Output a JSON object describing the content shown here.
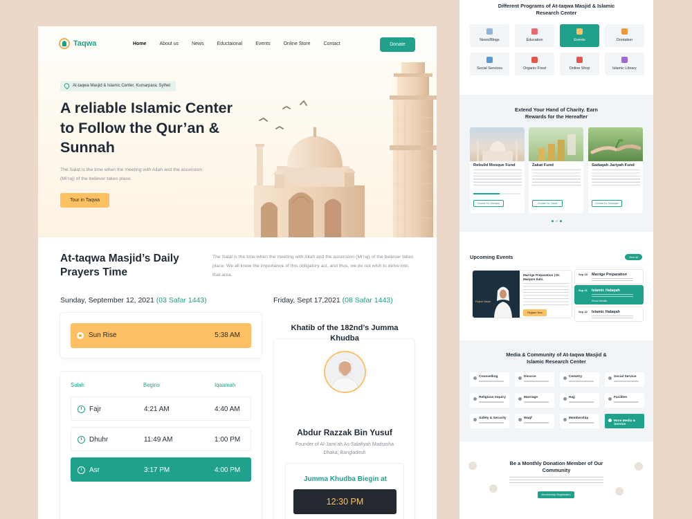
{
  "nav": {
    "brand": "Taqwa",
    "items": [
      "Home",
      "About us",
      "News",
      "Eductaional",
      "Events",
      "Online Store",
      "Contact"
    ],
    "donate": "Donate"
  },
  "hero": {
    "location": "At-taqwa Masjid & Islamic Center, Kumarpara, Sylhet",
    "title": "A reliable Islamic Center to Follow the Qur’an & Sunnah",
    "text": "The Salat is the time when the meeting with Allah and the ascension (Mi’raj) of the believer takes place.",
    "cta": "Tour in Taqwa"
  },
  "prayers": {
    "title": "At-taqwa Masjid’s Daily Prayers Time",
    "text": "The Salat is the time when the meeting with Allah and the ascension (Mi’raj) of the believer takes place. We all know the importance of this obligatory act, and thus, we do not wish to delve into that area.",
    "date": "Sunday, September 12, 2021",
    "hijri": "(03 Safar 1443)",
    "sunrise": {
      "label": "Sun Rise",
      "time": "5:38 AM"
    },
    "headers": [
      "Salah",
      "Begins",
      "Iqaamah"
    ],
    "rows": [
      {
        "name": "Fajr",
        "begins": "4:21 AM",
        "iqaamah": "4:40 AM"
      },
      {
        "name": "Dhuhr",
        "begins": "11:49 AM",
        "iqaamah": "1:00 PM"
      },
      {
        "name": "Asr",
        "begins": "3:17 PM",
        "iqaamah": "4:00 PM"
      }
    ]
  },
  "khutba": {
    "date": "Friday, Sept 17,2021",
    "hijri": "(08 Safar 1443)",
    "title": "Khatib of the 182nd’s Jumma Khudba",
    "name": "Abdur Razzak Bin Yusuf",
    "sub1": "Founder of Al-Jami’ah As-Salafiyah Madrasha",
    "sub2": "Dhaka, Bangladesh",
    "begin_label": "Jumma Khudba Biegin at",
    "begin_time": "12:30 PM"
  },
  "programs": {
    "title": "Different Programs of At-taqwa Masjid & Islamic Research Center",
    "items": [
      {
        "label": "News/Blogs",
        "icon": "newspaper-icon",
        "color": "#8fb3d9"
      },
      {
        "label": "Education",
        "icon": "education-icon",
        "color": "#e66b6b"
      },
      {
        "label": "Events",
        "icon": "calendar-icon",
        "color": "#fdc163"
      },
      {
        "label": "Dontation",
        "icon": "donation-icon",
        "color": "#e89a3c"
      },
      {
        "label": "Social Services",
        "icon": "social-icon",
        "color": "#5b9bd5"
      },
      {
        "label": "Organic Food",
        "icon": "food-icon",
        "color": "#e4584b"
      },
      {
        "label": "Online Shop",
        "icon": "shop-icon",
        "color": "#e4584b"
      },
      {
        "label": "Islamic Library",
        "icon": "library-icon",
        "color": "#9c6ad0"
      }
    ]
  },
  "charity": {
    "title": "Extend Your Hand of Charity. Earn Rewards for the Hereafter",
    "cards": [
      {
        "title": "Rebuild Mosque Fund",
        "button": "Donate for Mosque",
        "progress": 0.55
      },
      {
        "title": "Zakat Fund",
        "button": "Donate for Zakat",
        "progress": 0
      },
      {
        "title": "Sadaqah Jariyah Fund",
        "button": "Donate for Sadaqah",
        "progress": 0
      }
    ]
  },
  "events": {
    "title": "Upcoming Events",
    "view_all": "View All",
    "featured_title": "Marrige Preparation | Dr. Manjure Ilahi.",
    "featured_image_text": "Fiqhul Nikah",
    "buy_label": "Register Now",
    "list": [
      {
        "date": "Sep 18",
        "name": "Marrige Preparation"
      },
      {
        "date": "Sep 21",
        "name": "Islamic Halaqah",
        "action": "Show Details"
      },
      {
        "date": "Sep 22",
        "name": "Islamic Halaqah"
      }
    ]
  },
  "media": {
    "title": "Media & Community of At-taqwa Masjid & Islamic Research Center",
    "items": [
      "Counselling",
      "Divorce",
      "Cemetry",
      "Social Service",
      "Religious Inquiry",
      "Marriage",
      "Hajj",
      "Facilites",
      "Safety & Security",
      "Waqf",
      "Membership",
      "More Media & Service"
    ]
  },
  "donation": {
    "title": "Be a Monthly Donation Member of Our Community",
    "button": "Membership Registration"
  }
}
